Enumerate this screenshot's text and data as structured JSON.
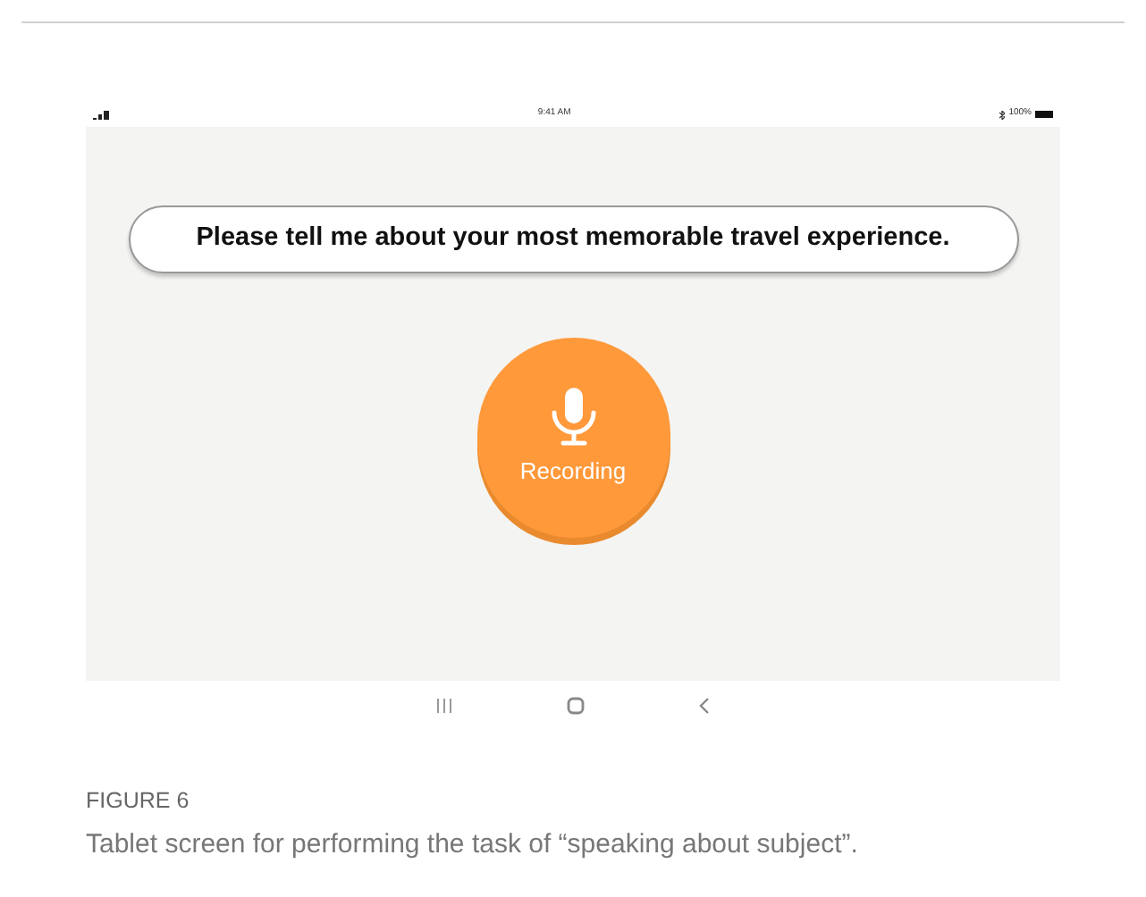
{
  "status_bar": {
    "time": "9:41 AM",
    "battery": "100%"
  },
  "prompt": "Please tell me about your most memorable travel experience.",
  "record_button": {
    "label": "Recording"
  },
  "caption": {
    "label": "FIGURE 6",
    "text": "Tablet screen for performing the task of “speaking about subject”."
  }
}
